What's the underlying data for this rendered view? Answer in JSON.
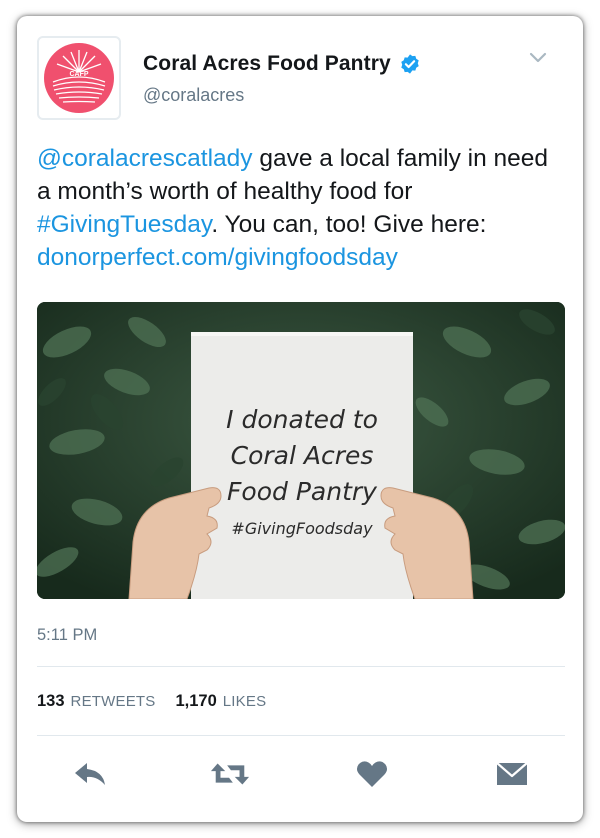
{
  "account": {
    "display_name": "Coral Acres Food Pantry",
    "handle": "@coralacres",
    "logo_text": "CAFP",
    "verified": true,
    "avatar_color": "#f0506e"
  },
  "tweet": {
    "mention": "@coralacrescatlady",
    "text_1": " gave a local family in need a month’s worth of healthy food for ",
    "hashtag": "#GivingTuesday",
    "text_2": ". You can, too! Give here: ",
    "url": "donorperfect.com/givingfoodsday"
  },
  "media": {
    "sign_line_1": "I donated to",
    "sign_line_2": "Coral Acres",
    "sign_line_3": "Food Pantry",
    "sign_line_4": "#GivingFoodsday"
  },
  "timestamp": "5:11 PM",
  "stats": {
    "retweets_count": "133",
    "retweets_label": "RETWEETS",
    "likes_count": "1,170",
    "likes_label": "LIKES"
  },
  "actions": {
    "reply_icon": "reply-icon",
    "retweet_icon": "retweet-icon",
    "like_icon": "heart-icon",
    "message_icon": "envelope-icon"
  },
  "colors": {
    "link": "#1b95e0",
    "icon": "#657786",
    "verified": "#1da1f2"
  }
}
